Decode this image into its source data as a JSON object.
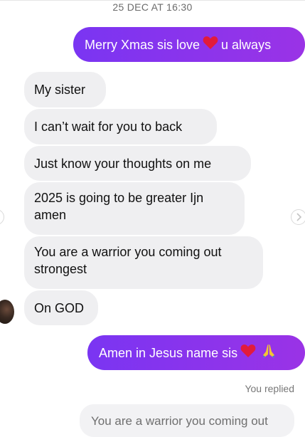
{
  "conversation": {
    "timestamp": "25 DEC AT 16:30",
    "messages": [
      {
        "id": "m1",
        "direction": "outgoing",
        "text_before": "Merry Xmas sis love",
        "text_after": "u always",
        "emoji": "red-heart"
      },
      {
        "id": "m2",
        "direction": "incoming",
        "text": "My sister"
      },
      {
        "id": "m3",
        "direction": "incoming",
        "text": "I can’t wait for you to back"
      },
      {
        "id": "m4",
        "direction": "incoming",
        "text": "Just know your thoughts on me"
      },
      {
        "id": "m5",
        "direction": "incoming",
        "text": "2025 is going to be greater Ijn amen"
      },
      {
        "id": "m6",
        "direction": "incoming",
        "text": "You are a warrior you coming out strongest"
      },
      {
        "id": "m7",
        "direction": "incoming",
        "text": "On GOD"
      },
      {
        "id": "m8",
        "direction": "outgoing",
        "text": "Amen in Jesus name sis",
        "emojis": [
          "red-heart",
          "folded-hands"
        ]
      }
    ],
    "reply_status": "You replied",
    "quoted_message": "You are a warrior you coming out"
  },
  "colors": {
    "outgoing_bubble_start": "#7a35f2",
    "outgoing_bubble_end": "#9a33e6",
    "incoming_bubble": "#efeff1",
    "timestamp_text": "#6b6b6b",
    "heart": "#e21b3c"
  },
  "icons": {
    "avatar": "avatar",
    "next": "chevron-right-icon",
    "prev": "chevron-left-icon"
  }
}
